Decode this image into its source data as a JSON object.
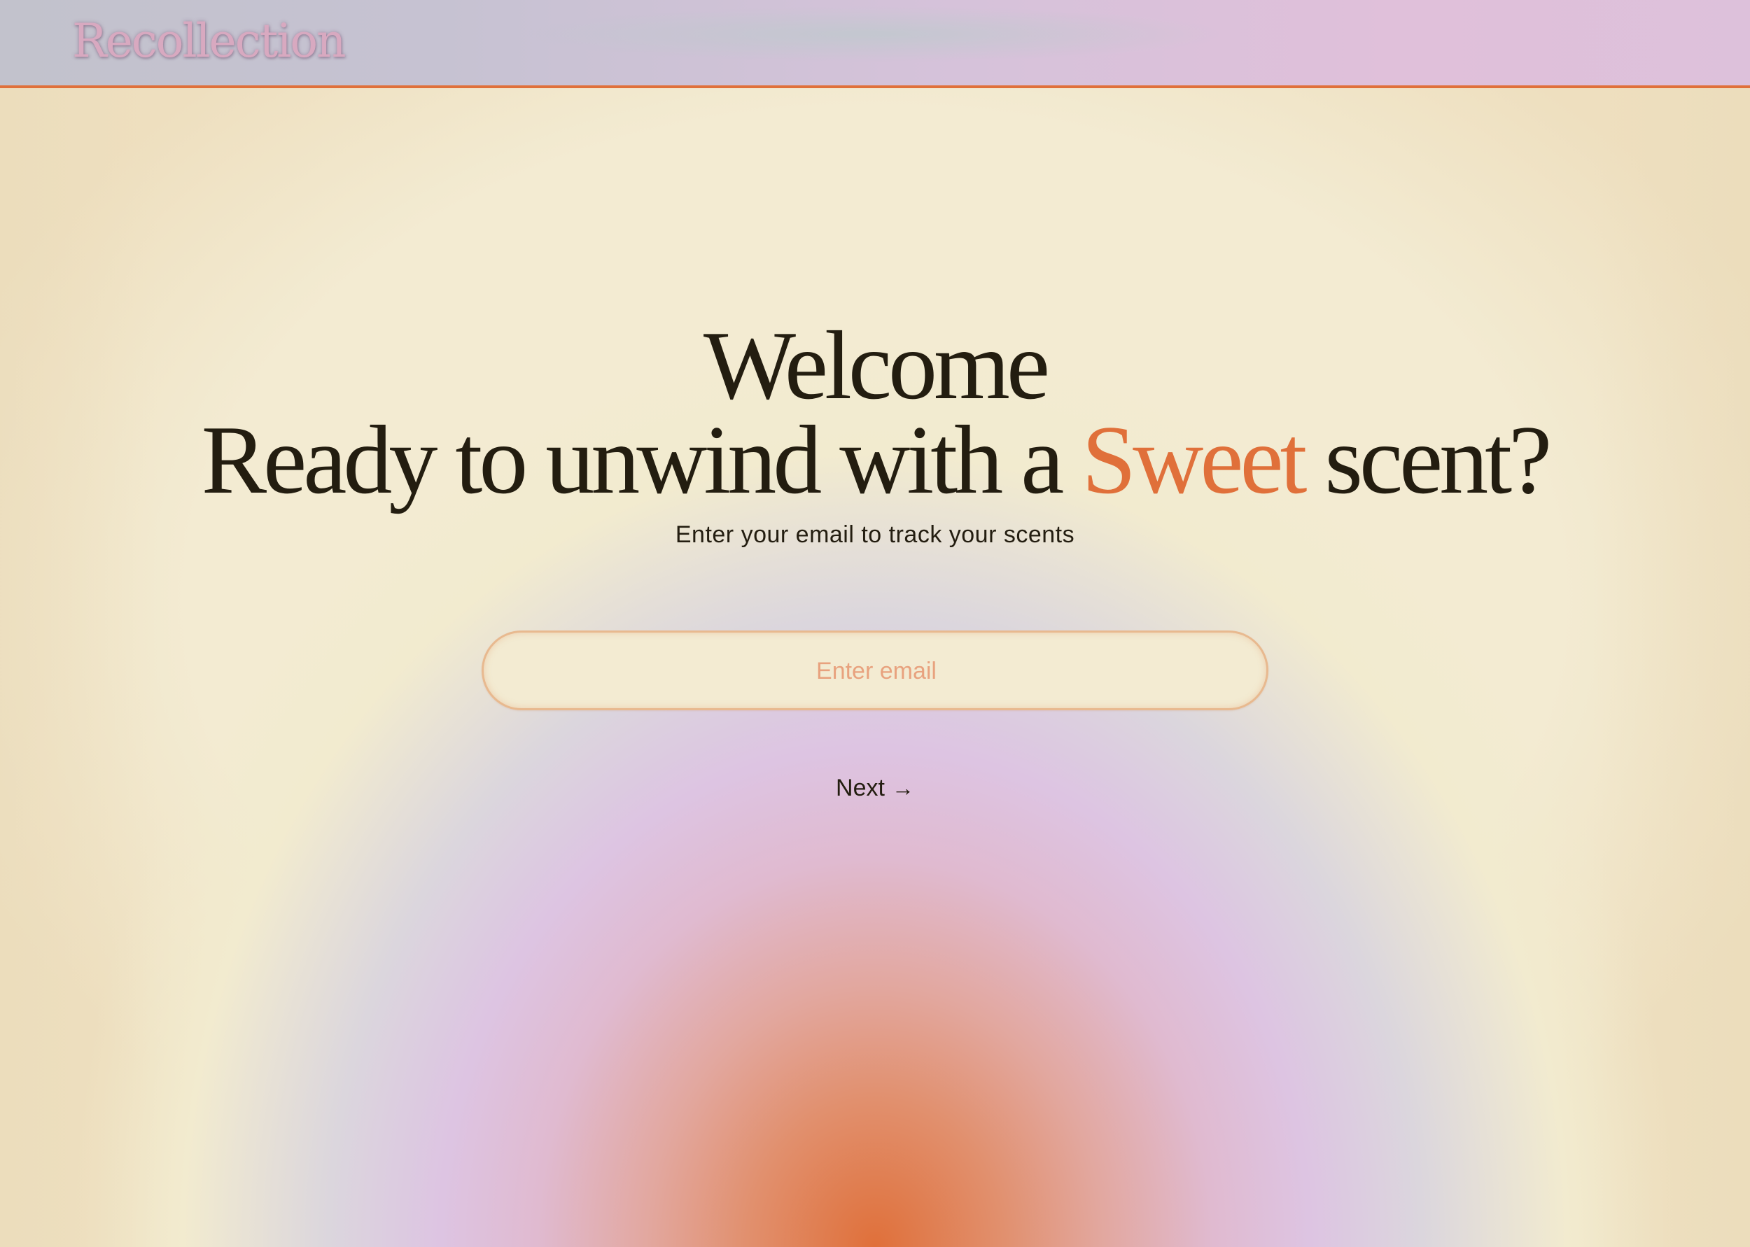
{
  "brand": {
    "name": "Recollection",
    "accent_color": "#e0703a",
    "text_color": "#231d10"
  },
  "hero": {
    "line1": "Welcome",
    "line2_prefix": "Ready to unwind with a",
    "line2_accent": "Sweet",
    "line2_suffix": "scent?",
    "subtitle": "Enter your email to track your scents"
  },
  "form": {
    "email": {
      "placeholder": "Enter email",
      "value": ""
    },
    "next_label": "Next",
    "next_icon": "arrow-right-icon"
  }
}
